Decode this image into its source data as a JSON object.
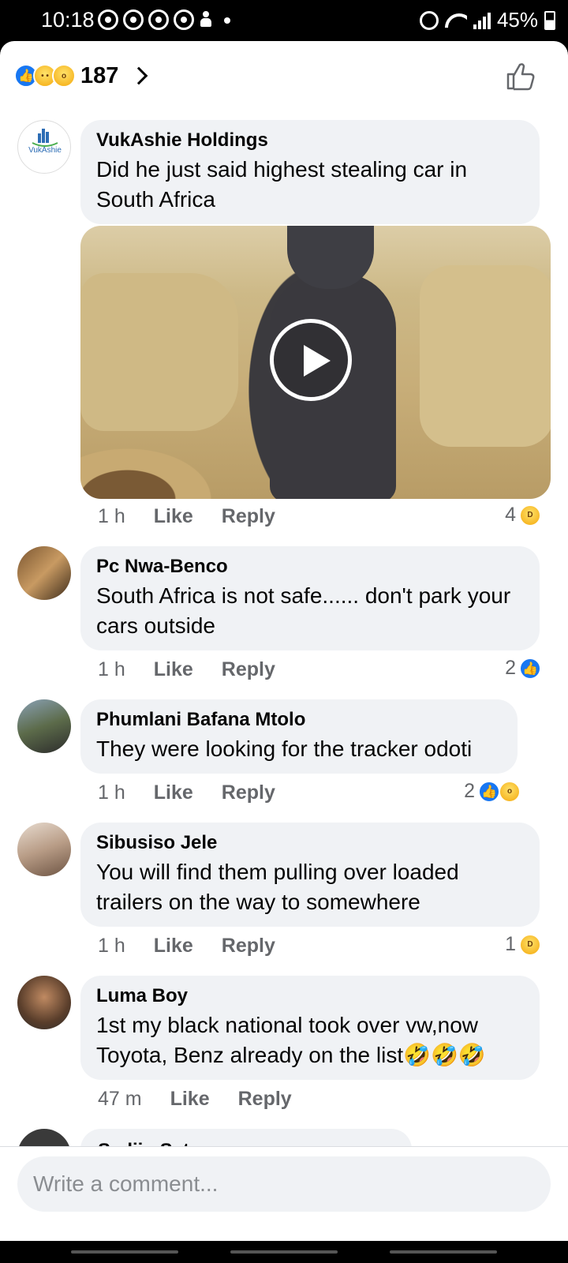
{
  "status_bar": {
    "time": "10:18",
    "battery": "45%"
  },
  "reactions_header": {
    "total": "187",
    "types": [
      "like",
      "sad",
      "wow"
    ]
  },
  "comments": [
    {
      "author": "VukAshie Holdings",
      "body": "Did he just said highest stealing car in South Africa",
      "time": "1 h",
      "like_label": "Like",
      "reply_label": "Reply",
      "reaction_count": "4",
      "reactions": [
        "haha"
      ],
      "has_video": true,
      "avatar_text": "VukAshie"
    },
    {
      "author": "Pc Nwa-Benco",
      "body": "South Africa is not safe...... don't park your cars outside",
      "time": "1 h",
      "like_label": "Like",
      "reply_label": "Reply",
      "reaction_count": "2",
      "reactions": [
        "like"
      ]
    },
    {
      "author": "Phumlani Bafana Mtolo",
      "body": "They were looking for the tracker odoti",
      "time": "1 h",
      "like_label": "Like",
      "reply_label": "Reply",
      "reaction_count": "2",
      "reactions": [
        "like",
        "wow"
      ]
    },
    {
      "author": "Sibusiso Jele",
      "body": "You will find them pulling over loaded trailers on the way to somewhere",
      "time": "1 h",
      "like_label": "Like",
      "reply_label": "Reply",
      "reaction_count": "1",
      "reactions": [
        "haha"
      ]
    },
    {
      "author": "Luma Boy",
      "body": "1st my black national took over vw,now Toyota, Benz already on the list🤣🤣🤣",
      "time": "47 m",
      "like_label": "Like",
      "reply_label": "Reply"
    }
  ],
  "partial_comment": {
    "author": "Sediju Setoe"
  },
  "composer": {
    "placeholder": "Write a comment..."
  },
  "colors": {
    "accent": "#1877f2",
    "bubble": "#f0f2f5",
    "meta_text": "#65676b"
  }
}
